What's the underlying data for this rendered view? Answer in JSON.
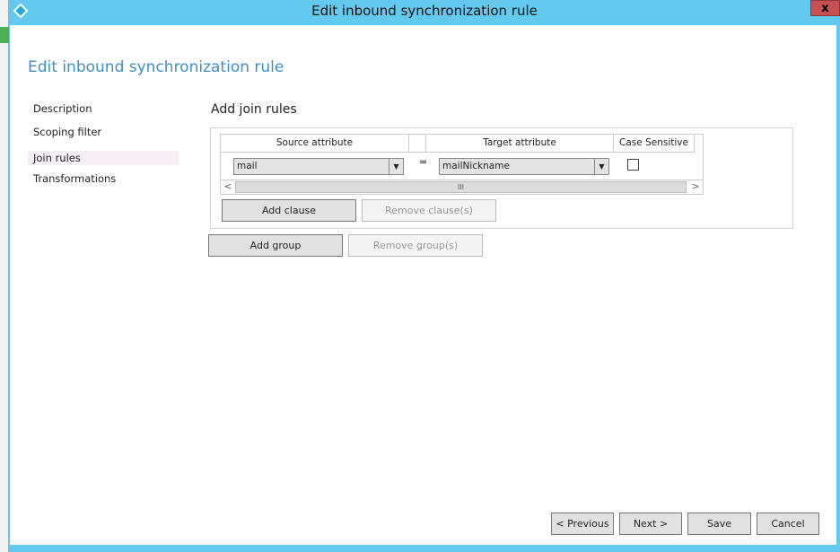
{
  "window": {
    "title": "Edit inbound synchronization rule",
    "close_label": "x",
    "accent": "#63c9ef",
    "close_color": "#c75050"
  },
  "heading": "Edit inbound synchronization rule",
  "nav": {
    "items": [
      {
        "label": "Description"
      },
      {
        "label": "Scoping filter"
      },
      {
        "label": "Join rules",
        "selected": true
      },
      {
        "label": "Transformations"
      }
    ]
  },
  "section_title": "Add join rules",
  "grid": {
    "headers": {
      "source": "Source attribute",
      "target": "Target attribute",
      "case": "Case Sensitive"
    },
    "rows": [
      {
        "source": "mail",
        "operator": "=",
        "target": "mailNickname",
        "case_sensitive": false
      }
    ],
    "scroll": {
      "left": "<",
      "right": ">",
      "thumb": "III"
    }
  },
  "buttons": {
    "add_clause": "Add clause",
    "remove_clause": "Remove clause(s)",
    "add_group": "Add group",
    "remove_group": "Remove group(s)",
    "previous": "< Previous",
    "next": "Next >",
    "save": "Save",
    "cancel": "Cancel"
  }
}
